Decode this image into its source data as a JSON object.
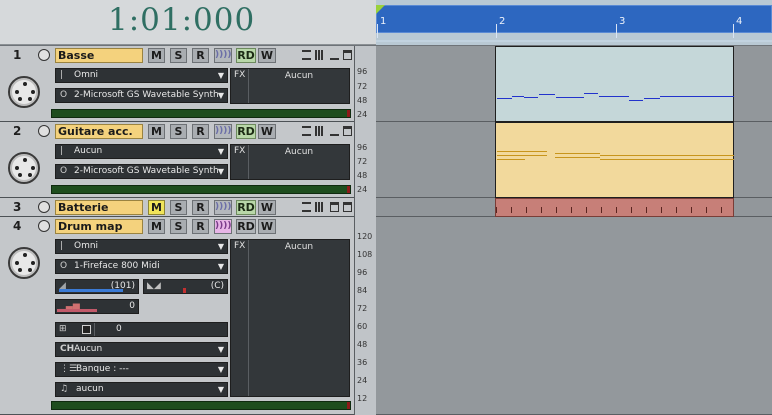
{
  "transport": {
    "time": "1:01:000"
  },
  "ruler": {
    "markers": [
      "1",
      "2",
      "3",
      "4"
    ]
  },
  "tracks": [
    {
      "number": "1",
      "name": "Basse",
      "buttons": {
        "mute": "M",
        "solo": "S",
        "record": "R",
        "rd": "RD",
        "write": "W"
      },
      "channel": "Omni",
      "output": "2-Microsoft GS Wavetable Synth",
      "fx_label": "FX",
      "fx_value": "Aucun",
      "scale": [
        "96",
        "72",
        "48",
        "24"
      ]
    },
    {
      "number": "2",
      "name": "Guitare acc.",
      "buttons": {
        "mute": "M",
        "solo": "S",
        "record": "R",
        "rd": "RD",
        "write": "W"
      },
      "channel": "Aucun",
      "output": "2-Microsoft GS Wavetable Synth",
      "fx_label": "FX",
      "fx_value": "Aucun",
      "scale": [
        "96",
        "72",
        "48",
        "24"
      ]
    },
    {
      "number": "3",
      "name": "Batterie",
      "buttons": {
        "mute": "M",
        "solo": "S",
        "record": "R",
        "rd": "RD",
        "write": "W"
      }
    },
    {
      "number": "4",
      "name": "Drum map",
      "buttons": {
        "mute": "M",
        "solo": "S",
        "record": "R",
        "rd": "RD",
        "write": "W"
      },
      "channel": "Omni",
      "output": "1-Fireface 800 Midi",
      "volume": "(101)",
      "pan": "(C)",
      "velocity": "0",
      "transpose": "0",
      "ch_label": "CH",
      "ch_value": "Aucun",
      "bank": "Banque : ---",
      "patch": "aucun",
      "fx_label": "FX",
      "fx_value": "Aucun",
      "scale": [
        "120",
        "108",
        "96",
        "84",
        "72",
        "60",
        "48",
        "36",
        "24",
        "12"
      ]
    }
  ],
  "colors": {
    "track_name_bg": "#f4d27d",
    "ruler_bar": "#2d67c0",
    "bass_clip": "#c5d7d9",
    "guitar_clip": "#f2d99c",
    "drum_clip": "#c77f78",
    "bass_note": "#2233cc",
    "guitar_note": "#c8951c"
  }
}
